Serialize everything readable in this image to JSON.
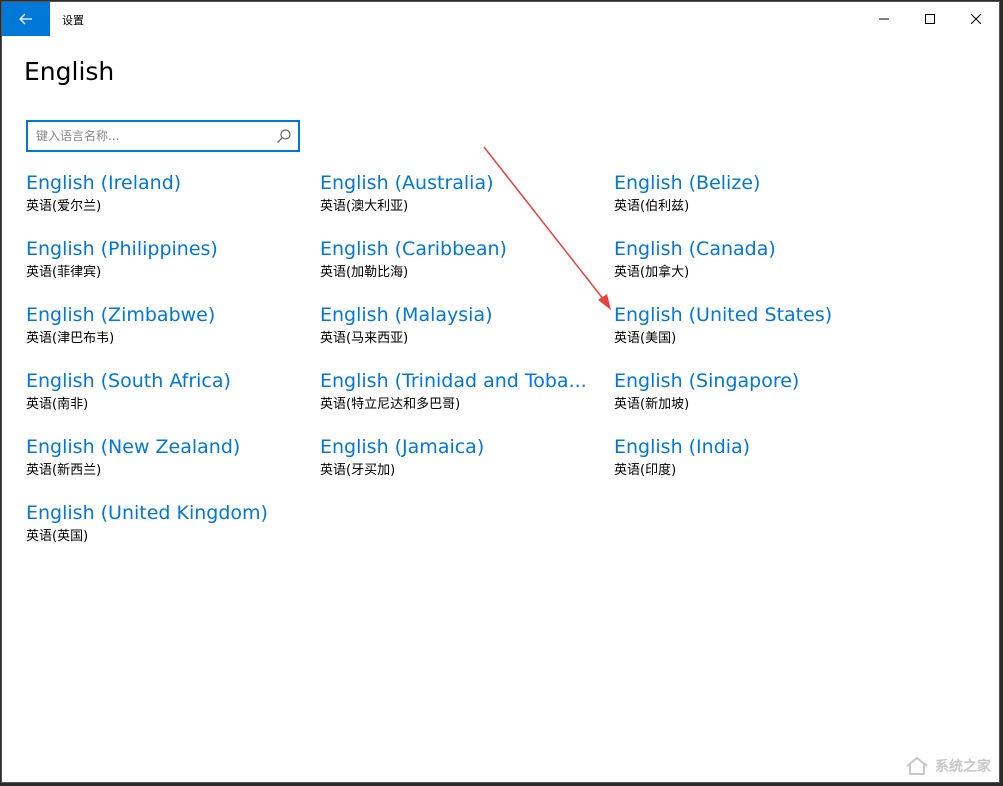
{
  "app": {
    "title": "设置"
  },
  "page": {
    "title": "English"
  },
  "search": {
    "placeholder": "键入语言名称..."
  },
  "languages": [
    {
      "name": "English (Ireland)",
      "native": "英语(爱尔兰)"
    },
    {
      "name": "English (Australia)",
      "native": "英语(澳大利亚)"
    },
    {
      "name": "English (Belize)",
      "native": "英语(伯利兹)"
    },
    {
      "name": "English (Philippines)",
      "native": "英语(菲律宾)"
    },
    {
      "name": "English (Caribbean)",
      "native": "英语(加勒比海)"
    },
    {
      "name": "English (Canada)",
      "native": "英语(加拿大)"
    },
    {
      "name": "English (Zimbabwe)",
      "native": "英语(津巴布韦)"
    },
    {
      "name": "English (Malaysia)",
      "native": "英语(马来西亚)"
    },
    {
      "name": "English (United States)",
      "native": "英语(美国)"
    },
    {
      "name": "English (South Africa)",
      "native": "英语(南非)"
    },
    {
      "name": "English (Trinidad and Toba...",
      "native": "英语(特立尼达和多巴哥)"
    },
    {
      "name": "English (Singapore)",
      "native": "英语(新加坡)"
    },
    {
      "name": "English (New Zealand)",
      "native": "英语(新西兰)"
    },
    {
      "name": "English (Jamaica)",
      "native": "英语(牙买加)"
    },
    {
      "name": "English (India)",
      "native": "英语(印度)"
    },
    {
      "name": "English (United Kingdom)",
      "native": "英语(英国)"
    }
  ],
  "watermark": {
    "text": "系统之家"
  },
  "colors": {
    "accent": "#0078d7",
    "annotation_arrow": "#e8433a"
  },
  "icons": [
    "back-arrow-icon",
    "minimize-icon",
    "maximize-icon",
    "close-icon",
    "search-icon"
  ]
}
